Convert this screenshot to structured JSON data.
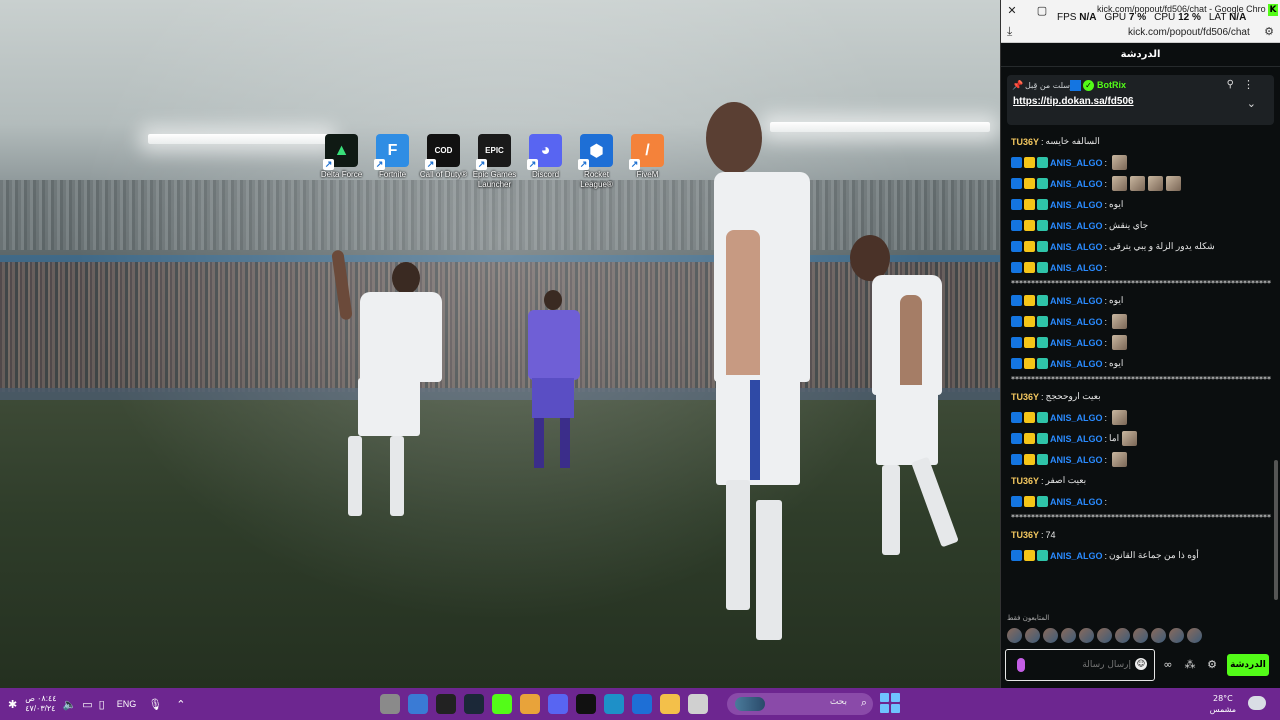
{
  "desktop": {
    "icons": [
      {
        "label": "Delta Force",
        "icon": "delta-force-icon",
        "bg": "#0f1a14",
        "fg": "#39e07a",
        "glyph": "▲"
      },
      {
        "label": "Fortnite",
        "icon": "fortnite-icon",
        "bg": "#2f8de4",
        "fg": "#ffffff",
        "glyph": "F"
      },
      {
        "label": "Call of Duty®",
        "icon": "call-of-duty-icon",
        "bg": "#111111",
        "fg": "#ffffff",
        "glyph": "COD"
      },
      {
        "label": "Epic Games Launcher",
        "icon": "epic-games-icon",
        "bg": "#1a1a1a",
        "fg": "#ffffff",
        "glyph": "EPIC"
      },
      {
        "label": "Discord",
        "icon": "discord-icon",
        "bg": "#5865f2",
        "fg": "#ffffff",
        "glyph": "◕"
      },
      {
        "label": "Rocket League®",
        "icon": "rocket-league-icon",
        "bg": "#1e6fd6",
        "fg": "#ffffff",
        "glyph": "⬢"
      },
      {
        "label": "FiveM",
        "icon": "fivem-icon",
        "bg": "#f4823a",
        "fg": "#ffffff",
        "glyph": "/"
      }
    ]
  },
  "window": {
    "title": "kick.com/popout/fd506/chat - Google Chro...",
    "url": "kick.com/popout/fd506/chat",
    "perf": {
      "fps_label": "FPS",
      "fps": "N/A",
      "gpu_label": "GPU",
      "gpu": "7 %",
      "cpu_label": "CPU",
      "cpu": "12 %",
      "lat_label": "LAT",
      "lat": "N/A"
    },
    "close_glyph": "✕",
    "restore_glyph": "▢"
  },
  "chat": {
    "header": "الدردشة",
    "pinned": {
      "sent_text": "أرسلت من قِبل",
      "username": "BotRix",
      "link": "https://tip.dokan.sa/fd506"
    },
    "messages": [
      {
        "type": "msg",
        "user": "TU36Y",
        "badges": [],
        "text": "السالفه خايسه",
        "emotes": 0
      },
      {
        "type": "msg",
        "user": "ANIS_ALGO",
        "badges": [
          "kick",
          "crown",
          "sub"
        ],
        "text": "",
        "emotes": 1
      },
      {
        "type": "msg",
        "user": "ANIS_ALGO",
        "badges": [
          "kick",
          "crown",
          "sub"
        ],
        "text": "",
        "emotes": 4
      },
      {
        "type": "msg",
        "user": "ANIS_ALGO",
        "badges": [
          "kick",
          "crown",
          "sub"
        ],
        "text": "ايوه",
        "emotes": 0
      },
      {
        "type": "msg",
        "user": "ANIS_ALGO",
        "badges": [
          "kick",
          "crown",
          "sub"
        ],
        "text": "جاي ينقش",
        "emotes": 0
      },
      {
        "type": "msg",
        "user": "ANIS_ALGO",
        "badges": [
          "kick",
          "crown",
          "sub"
        ],
        "text": "شكله يدور الزلة و يبي يترقى",
        "emotes": 0
      },
      {
        "type": "msg",
        "user": "ANIS_ALGO",
        "badges": [
          "kick",
          "crown",
          "sub"
        ],
        "text": "",
        "emotes": 0
      },
      {
        "type": "spam",
        "text": "********************************************************************"
      },
      {
        "type": "msg",
        "user": "ANIS_ALGO",
        "badges": [
          "kick",
          "crown",
          "sub"
        ],
        "text": "ايوه",
        "emotes": 0
      },
      {
        "type": "msg",
        "user": "ANIS_ALGO",
        "badges": [
          "kick",
          "crown",
          "sub"
        ],
        "text": "",
        "emotes": 1
      },
      {
        "type": "msg",
        "user": "ANIS_ALGO",
        "badges": [
          "kick",
          "crown",
          "sub"
        ],
        "text": "",
        "emotes": 1
      },
      {
        "type": "msg",
        "user": "ANIS_ALGO",
        "badges": [
          "kick",
          "crown",
          "sub"
        ],
        "text": "ايوه",
        "emotes": 0
      },
      {
        "type": "spam",
        "text": "********************************************************************"
      },
      {
        "type": "msg",
        "user": "TU36Y",
        "badges": [],
        "text": "بعيت اروححجج",
        "emotes": 0
      },
      {
        "type": "msg",
        "user": "ANIS_ALGO",
        "badges": [
          "kick",
          "crown",
          "sub"
        ],
        "text": "",
        "emotes": 1
      },
      {
        "type": "msg",
        "user": "ANIS_ALGO",
        "badges": [
          "kick",
          "crown",
          "sub"
        ],
        "text": "اما",
        "emotes": 1
      },
      {
        "type": "msg",
        "user": "ANIS_ALGO",
        "badges": [
          "kick",
          "crown",
          "sub"
        ],
        "text": "",
        "emotes": 1
      },
      {
        "type": "msg",
        "user": "TU36Y",
        "badges": [],
        "text": "بعيت اصفر",
        "emotes": 0
      },
      {
        "type": "msg",
        "user": "ANIS_ALGO",
        "badges": [
          "kick",
          "crown",
          "sub"
        ],
        "text": "",
        "emotes": 0
      },
      {
        "type": "spam",
        "text": "********************************************************************"
      },
      {
        "type": "msg",
        "user": "TU36Y",
        "badges": [],
        "text": "74",
        "emotes": 0
      },
      {
        "type": "msg",
        "user": "ANIS_ALGO",
        "badges": [
          "kick",
          "crown",
          "sub"
        ],
        "text": "أوه ذا من جماعة القانون",
        "emotes": 0
      }
    ],
    "viewers_label": "المتابعون فقط",
    "viewer_count": 11,
    "input_placeholder": "إرسال رسالة",
    "send_label": "الدردشة"
  },
  "taskbar": {
    "time": "٠٨:٤٤ ص",
    "date": "٤٧/٠٣/٢٤",
    "lang": "ENG",
    "search_placeholder": "بحث",
    "weather_temp": "28°C",
    "weather_desc": "مشمس",
    "apps": [
      {
        "name": "settings-app",
        "color": "#8a8a8a"
      },
      {
        "name": "store-app",
        "color": "#3a7bd5"
      },
      {
        "name": "epic-app",
        "color": "#222222"
      },
      {
        "name": "steam-app",
        "color": "#1b2838"
      },
      {
        "name": "kick-app",
        "color": "#53fc18"
      },
      {
        "name": "chrome-app",
        "color": "#e8a33a"
      },
      {
        "name": "discord-app",
        "color": "#5865f2"
      },
      {
        "name": "cod-app",
        "color": "#111111"
      },
      {
        "name": "edge-app",
        "color": "#1e90c8"
      },
      {
        "name": "rocket-league-app",
        "color": "#1e6fd6"
      },
      {
        "name": "explorer-app",
        "color": "#f3c04a"
      },
      {
        "name": "files-app",
        "color": "#d0d0d0"
      }
    ]
  }
}
